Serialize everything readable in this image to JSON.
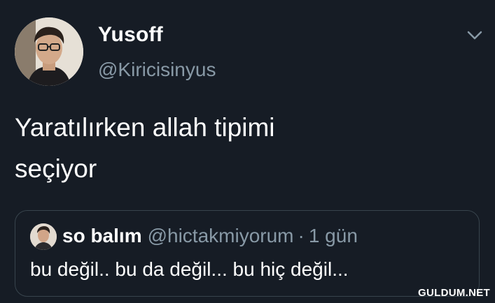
{
  "tweet": {
    "author_name": "Yusoff",
    "author_handle": "@Kiricisinyus",
    "text_line1": "Yaratılırken allah tipimi",
    "text_line2": "seçiyor",
    "menu_icon": "chevron-down-icon"
  },
  "quoted_tweet": {
    "author_name": "so balım",
    "author_handle": "@hictakmiyorum",
    "separator": "·",
    "time": "1 gün",
    "text": "bu değil.. bu da değil... bu hiç değil..."
  },
  "watermark": "GULDUM.NET",
  "colors": {
    "background": "#161c25",
    "text": "#ffffff",
    "secondary_text": "#8899a6",
    "card_border": "#38444d"
  }
}
